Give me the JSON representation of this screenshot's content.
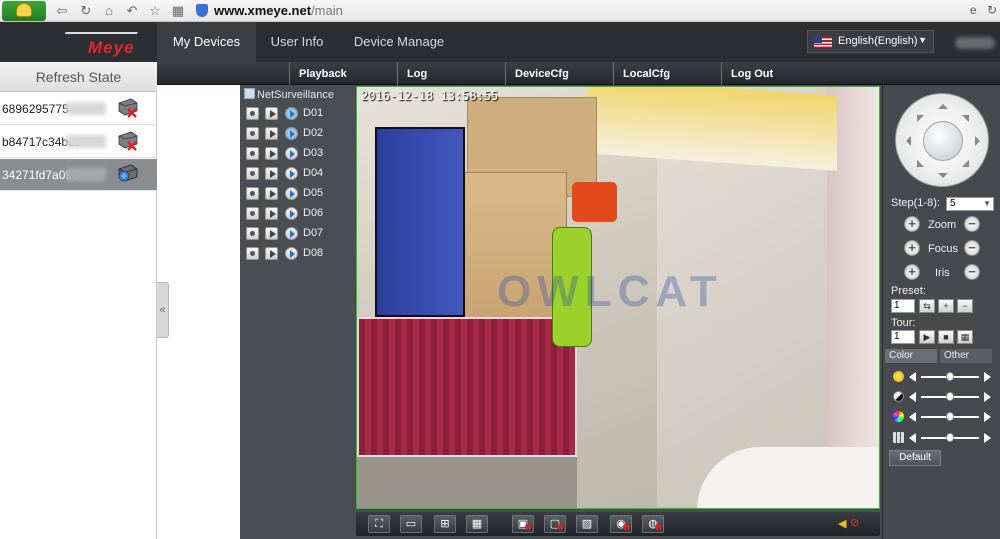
{
  "browser": {
    "url_host": "www.xmeye.net",
    "url_path": "/main"
  },
  "header": {
    "logo_text": "Meye",
    "tabs": [
      {
        "label": "My Devices",
        "active": true
      },
      {
        "label": "User Info",
        "active": false
      },
      {
        "label": "Device Manage",
        "active": false
      }
    ],
    "language": "English(English)"
  },
  "subnav": [
    "Playback",
    "Log",
    "DeviceCfg",
    "LocalCfg",
    "Log Out"
  ],
  "devices": {
    "refresh_label": "Refresh State",
    "items": [
      {
        "id": "6896295775",
        "status": "offline",
        "selected": false
      },
      {
        "id": "b84717c34bcc",
        "status": "offline",
        "selected": false
      },
      {
        "id": "34271fd7a090",
        "status": "online",
        "selected": true
      }
    ]
  },
  "tree": {
    "root": "NetSurveillance",
    "channels": [
      "D01",
      "D02",
      "D03",
      "D04",
      "D05",
      "D06",
      "D07",
      "D08"
    ],
    "active_channels": [
      "D01",
      "D02"
    ]
  },
  "video": {
    "osd_timestamp": "2016-12-18 13:58:55",
    "watermark": "OWLCAT"
  },
  "ptz": {
    "step_label": "Step(1-8):",
    "step_value": "5",
    "zoom_label": "Zoom",
    "focus_label": "Focus",
    "iris_label": "Iris",
    "preset_label": "Preset:",
    "preset_value": "1",
    "tour_label": "Tour:",
    "tour_value": "1",
    "tabs": [
      "Color",
      "Other"
    ],
    "color_levels": [
      0.5,
      0.5,
      0.5,
      0.5
    ],
    "default_label": "Default"
  },
  "colors": {
    "header_bg": "#2b2e32",
    "active_tab_bg": "#3b3f44",
    "video_border": "#2cbf2c",
    "logo_red": "#e3272a"
  }
}
